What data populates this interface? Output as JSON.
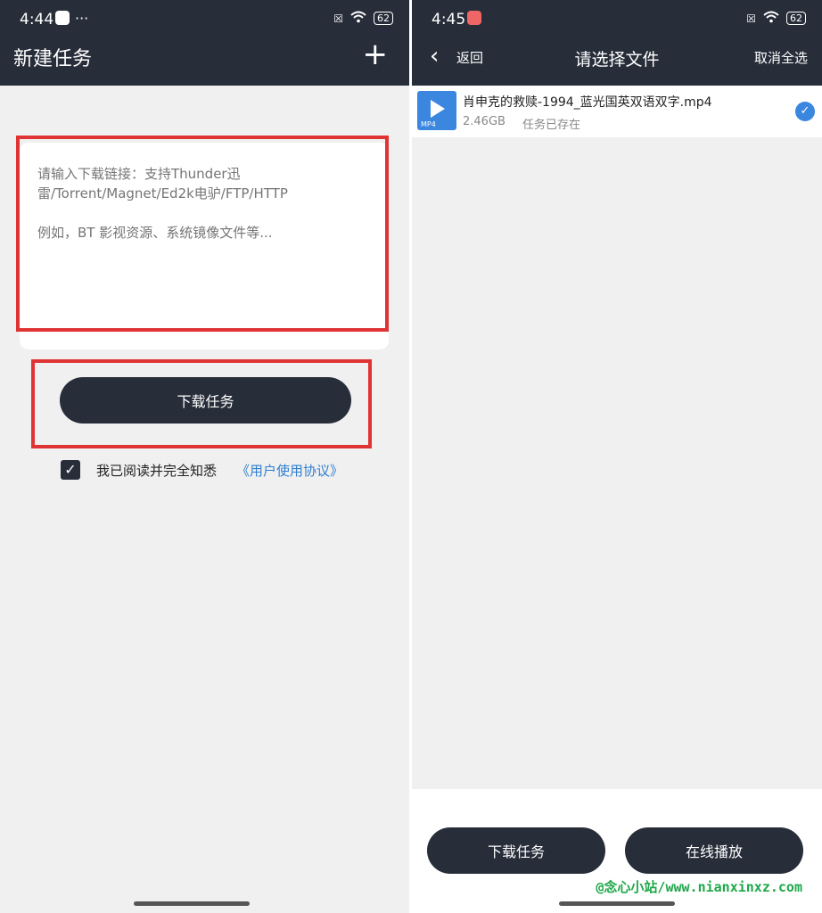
{
  "left_screen": {
    "status_time": "4:44",
    "status_dots": "···",
    "battery": "62",
    "title": "新建任务",
    "add_icon": "plus-icon",
    "input": {
      "placeholder": "请输入下载链接：支持Thunder迅雷/Torrent/Magnet/Ed2k电驴/FTP/HTTP\n\n例如，BT 影视资源、系统镜像文件等...",
      "value": ""
    },
    "download_button": "下载任务",
    "agree_checked": true,
    "agree_text": "我已阅读并完全知悉",
    "agree_link": "《用户使用协议》",
    "highlight_color": "#e03333"
  },
  "right_screen": {
    "status_time": "4:45",
    "battery": "62",
    "back_label": "返回",
    "title": "请选择文件",
    "deselect_all": "取消全选",
    "files": [
      {
        "name": "肖申克的救赎-1994_蓝光国英双语双字.mp4",
        "ext": "MP4",
        "size": "2.46GB",
        "status": "任务已存在",
        "selected": true
      }
    ],
    "download_button": "下载任务",
    "play_online_button": "在线播放"
  },
  "watermark": "@念心小站/www.nianxinxz.com",
  "colors": {
    "appbar": "#272d39",
    "accent_blue": "#3b87e0",
    "link_blue": "#2f7fd0",
    "background": "#f0f0f0"
  }
}
